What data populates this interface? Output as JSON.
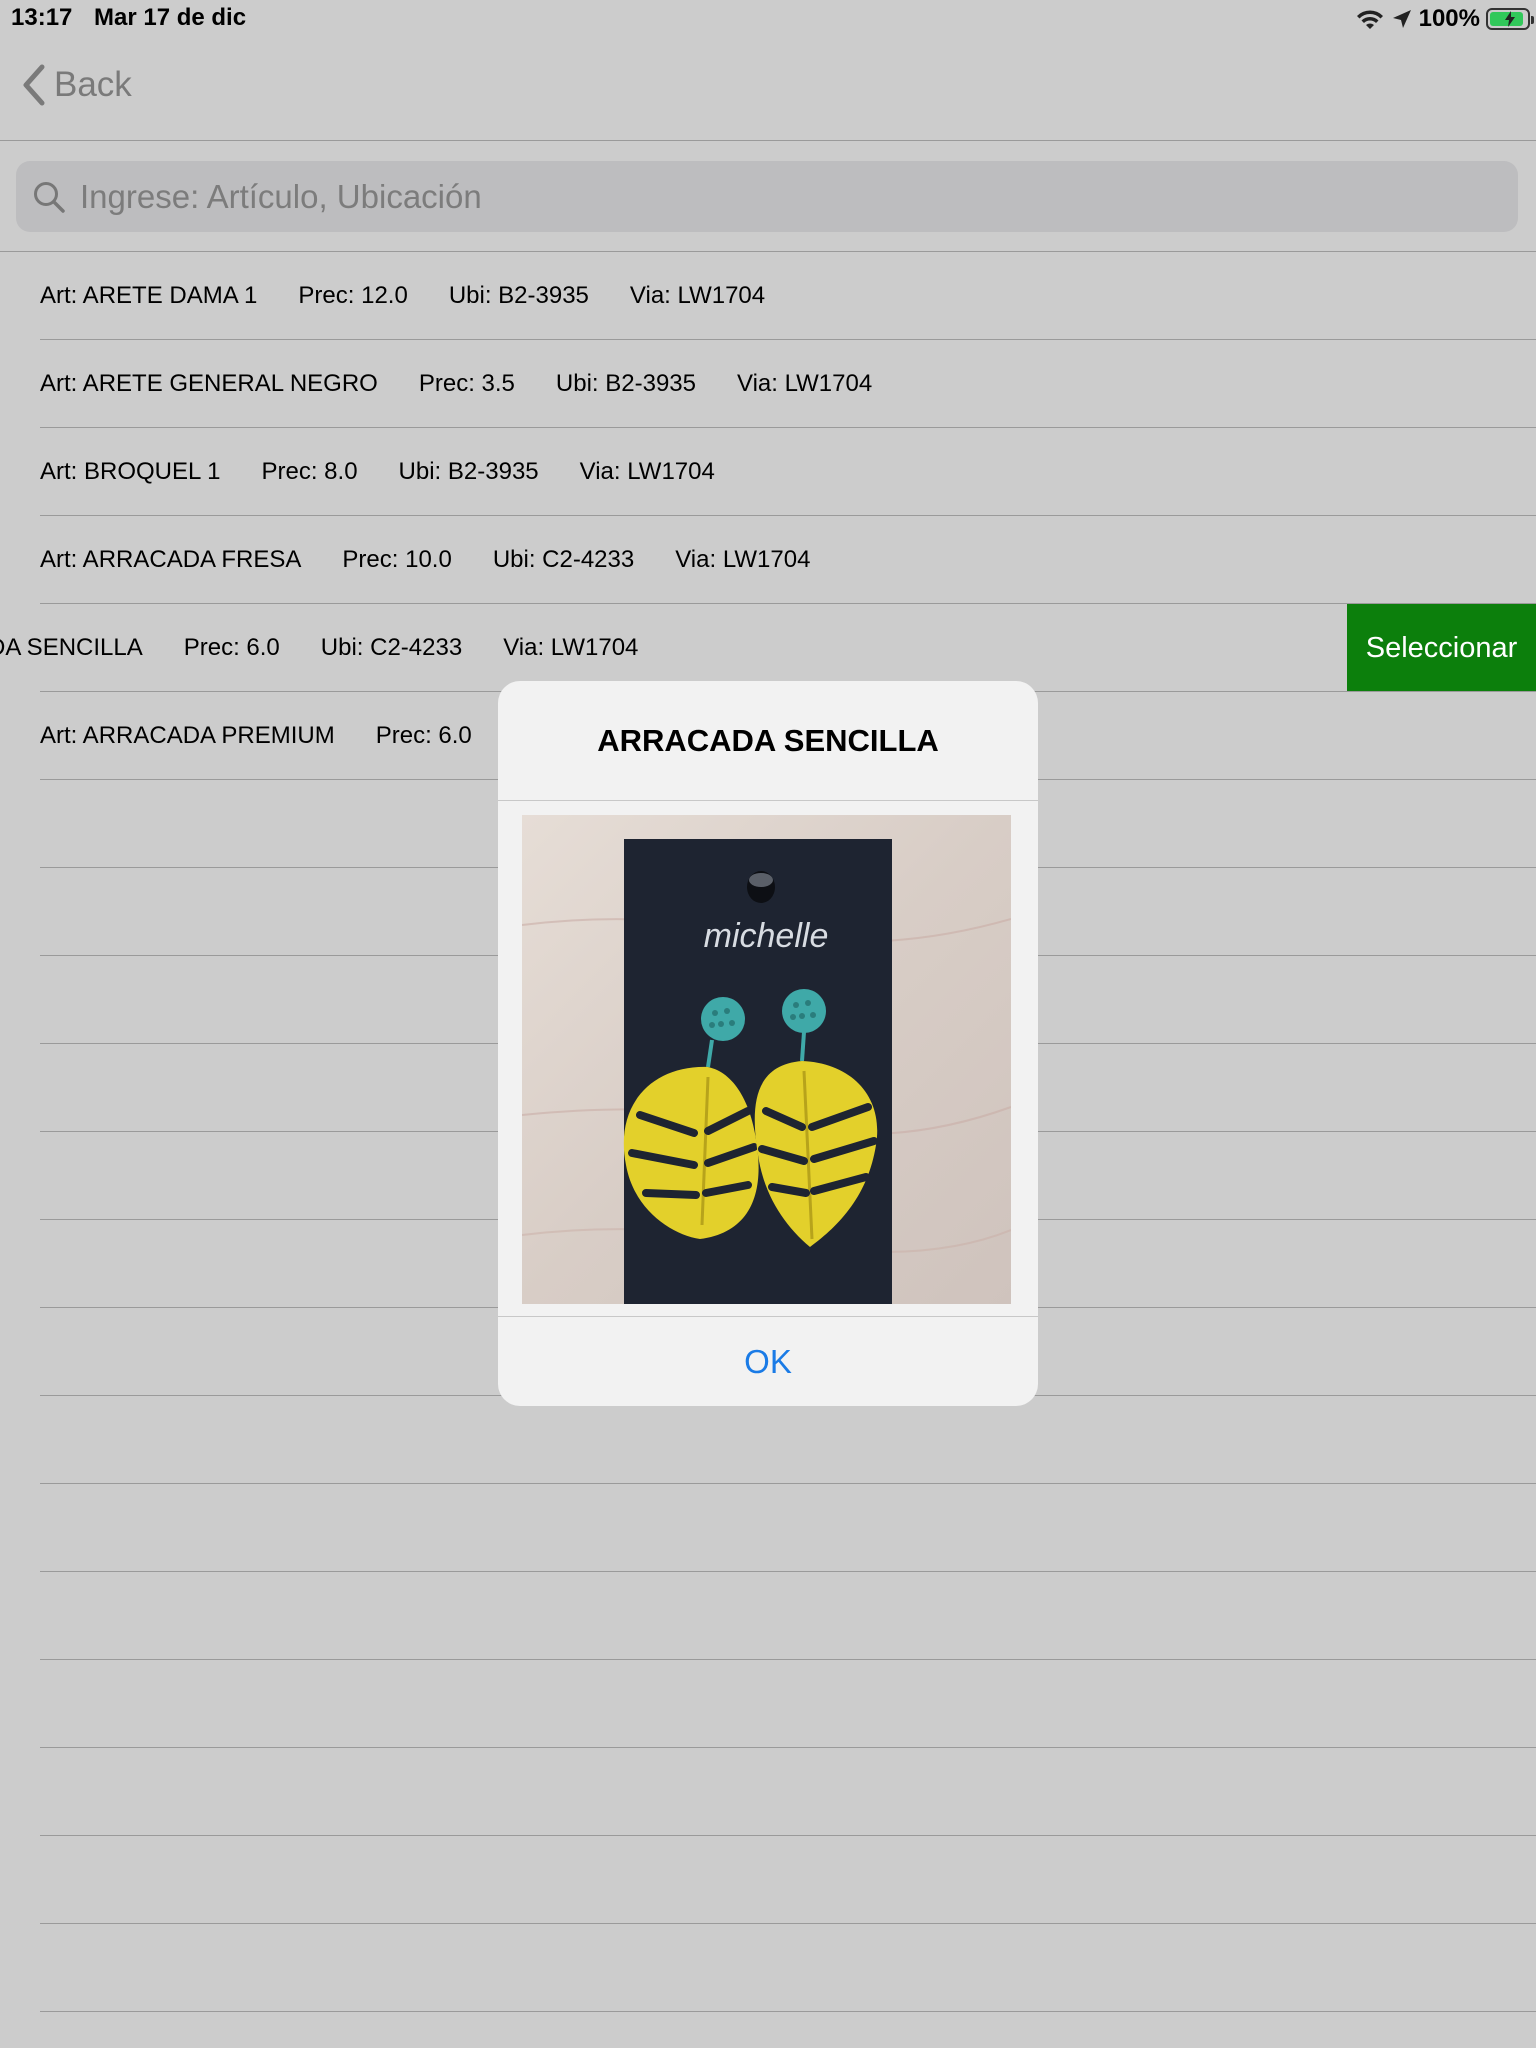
{
  "status_bar": {
    "time": "13:17",
    "date": "Mar 17 de dic",
    "battery": "100%"
  },
  "nav": {
    "back_label": "Back"
  },
  "search": {
    "placeholder": "Ingrese: Artículo, Ubicación"
  },
  "rows": [
    {
      "art": "Art: ARETE DAMA 1",
      "prec": "Prec: 12.0",
      "ubi": "Ubi: B2-3935",
      "via": "Via: LW1704"
    },
    {
      "art": "Art: ARETE GENERAL NEGRO",
      "prec": "Prec: 3.5",
      "ubi": "Ubi: B2-3935",
      "via": "Via: LW1704"
    },
    {
      "art": "Art: BROQUEL 1",
      "prec": "Prec: 8.0",
      "ubi": "Ubi: B2-3935",
      "via": "Via: LW1704"
    },
    {
      "art": "Art: ARRACADA FRESA",
      "prec": "Prec: 10.0",
      "ubi": "Ubi: C2-4233",
      "via": "Via: LW1704"
    },
    {
      "art": "DA SENCILLA",
      "prec": "Prec: 6.0",
      "ubi": "Ubi: C2-4233",
      "via": "Via: LW1704",
      "action": "Seleccionar"
    },
    {
      "art": "Art: ARRACADA PREMIUM",
      "prec": "Prec: 6.0"
    }
  ],
  "dialog": {
    "title": "ARRACADA SENCILLA",
    "image_logo": "michelle",
    "ok_label": "OK"
  },
  "colors": {
    "background": "#cccccc",
    "select_button": "#0c7f0c",
    "ok_text": "#1a7be6",
    "dialog_bg": "#f2f2f2"
  }
}
